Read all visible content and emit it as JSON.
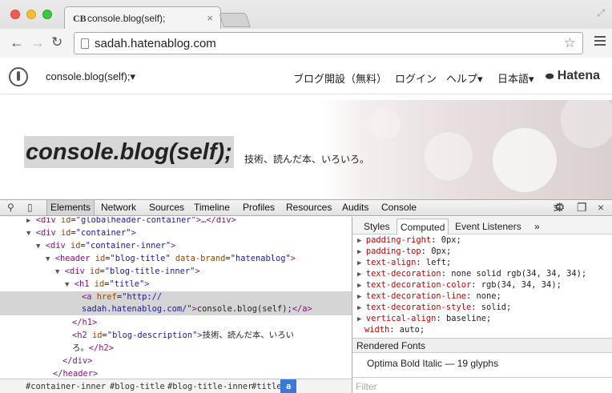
{
  "window": {
    "tab_favicon": "CB",
    "tab_title": "console.blog(self);",
    "tab_close": "×",
    "fullscreen": "⤢"
  },
  "toolbar": {
    "back": "←",
    "forward": "→",
    "reload": "↻",
    "url": "sadah.hatenablog.com",
    "bookmark_star": "☆"
  },
  "globalheader": {
    "blog_name": "console.blog(self);",
    "dropdown_caret": "▾",
    "links": [
      "ブログ開設（無料）",
      "ログイン",
      "ヘルプ",
      "日本語"
    ],
    "carets": [
      "▾",
      "▾"
    ],
    "hatena_mark": "⬬",
    "hatena": "Hatena"
  },
  "blog": {
    "title": "console.blog(self);",
    "description": "技術、読んだ本、いろいろ。"
  },
  "devtools": {
    "search_icon": "⚲",
    "device_icon": "▯",
    "tabs": [
      "Elements",
      "Network",
      "Sources",
      "Timeline",
      "Profiles",
      "Resources",
      "Audits",
      "Console"
    ],
    "right_icons": [
      "⋝",
      "⚙",
      "❐",
      "×"
    ],
    "dom": {
      "l1_tag_open": "<div ",
      "l1_attr": "id",
      "l1_val": "\"globalheader-container\"",
      "l1_tail": ">…</div>",
      "l2_tag_open": "<div ",
      "l2_attr": "id",
      "l2_val": "\"container\"",
      "l2_tail": ">",
      "l3_tag_open": "<div ",
      "l3_attr": "id",
      "l3_val": "\"container-inner\"",
      "l3_tail": ">",
      "l4_tag_open": "<header ",
      "l4_attr": "id",
      "l4_val": "\"blog-title\"",
      "l4_attr2": "data-brand",
      "l4_val2": "\"hatenablog\"",
      "l4_tail": ">",
      "l5_tag_open": "<div ",
      "l5_attr": "id",
      "l5_val": "\"blog-title-inner\"",
      "l5_tail": ">",
      "l6_tag_open": "<h1 ",
      "l6_attr": "id",
      "l6_val": "\"title\"",
      "l6_tail": ">",
      "l7_tag_open": "<a ",
      "l7_attr": "href",
      "l7_val": "\"http://",
      "l8_val": "sadah.hatenablog.com/\"",
      "l8_tag": ">",
      "l8_text": "console.blog(self);",
      "l8_close": "</a>",
      "l9_close": "</h1>",
      "l10_tag_open": "<h2 ",
      "l10_attr": "id",
      "l10_val": "\"blog-description\"",
      "l10_tag": ">",
      "l10_text": "技術、読んだ本、いろい",
      "l11_text": "ろ。",
      "l11_close": "</h2>",
      "l12_close": "</div>",
      "l13_close": "</header>"
    },
    "breadcrumbs": [
      "#container-inner",
      "#blog-title",
      "#blog-title-inner",
      "#title",
      "a"
    ],
    "sidebar_tabs": [
      "Styles",
      "Computed",
      "Event Listeners",
      "»"
    ],
    "computed": [
      {
        "name": "padding-right",
        "value": "0px;"
      },
      {
        "name": "padding-top",
        "value": "0px;"
      },
      {
        "name": "text-align",
        "value": "left;"
      },
      {
        "name": "text-decoration",
        "value": "none solid rgb(34, 34, 34);"
      },
      {
        "name": "text-decoration-color",
        "value": "rgb(34, 34, 34);"
      },
      {
        "name": "text-decoration-line",
        "value": "none;"
      },
      {
        "name": "text-decoration-style",
        "value": "solid;"
      },
      {
        "name": "vertical-align",
        "value": "baseline;"
      },
      {
        "name": "width",
        "value": "auto;"
      }
    ],
    "rendered_fonts_header": "Rendered Fonts",
    "rendered_font": "Optima Bold Italic — 19 glyphs",
    "filter_placeholder": "Filter"
  }
}
